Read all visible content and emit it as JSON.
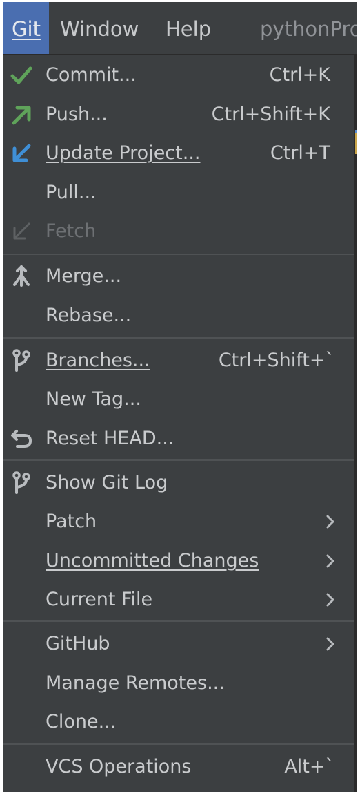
{
  "menubar": {
    "git": "Git",
    "window": "Window",
    "help": "Help",
    "project": "pythonPro"
  },
  "menu": {
    "commit": {
      "label": "Commit...",
      "shortcut": "Ctrl+K",
      "icon": "check-icon"
    },
    "push": {
      "label": "Push...",
      "shortcut": "Ctrl+Shift+K",
      "icon": "push-arrow-icon"
    },
    "update_project": {
      "label": "Update Project...",
      "shortcut": "Ctrl+T",
      "icon": "update-arrow-icon"
    },
    "pull": {
      "label": "Pull..."
    },
    "fetch": {
      "label": "Fetch",
      "icon": "fetch-icon",
      "enabled": false
    },
    "merge": {
      "label": "Merge...",
      "icon": "merge-icon"
    },
    "rebase": {
      "label": "Rebase..."
    },
    "branches": {
      "label": "Branches...",
      "shortcut": "Ctrl+Shift+`",
      "icon": "branch-icon"
    },
    "new_tag": {
      "label": "New Tag..."
    },
    "reset_head": {
      "label": "Reset HEAD...",
      "icon": "undo-icon"
    },
    "show_git_log": {
      "label": "Show Git Log",
      "icon": "branch-icon"
    },
    "patch": {
      "label": "Patch",
      "submenu": true
    },
    "uncommitted_changes": {
      "label": "Uncommitted Changes",
      "submenu": true
    },
    "current_file": {
      "label": "Current File",
      "submenu": true
    },
    "github": {
      "label": "GitHub",
      "submenu": true
    },
    "manage_remotes": {
      "label": "Manage Remotes..."
    },
    "clone": {
      "label": "Clone..."
    },
    "vcs_operations": {
      "label": "VCS Operations",
      "shortcut": "Alt+`"
    }
  },
  "colors": {
    "menu_bg": "#3c3f41",
    "highlight": "#4a6eb0",
    "text": "#c9cbcd",
    "disabled_text": "#6d7073",
    "check_green": "#5fa35a",
    "push_green": "#5fa35a",
    "update_blue": "#3f8fd6"
  }
}
